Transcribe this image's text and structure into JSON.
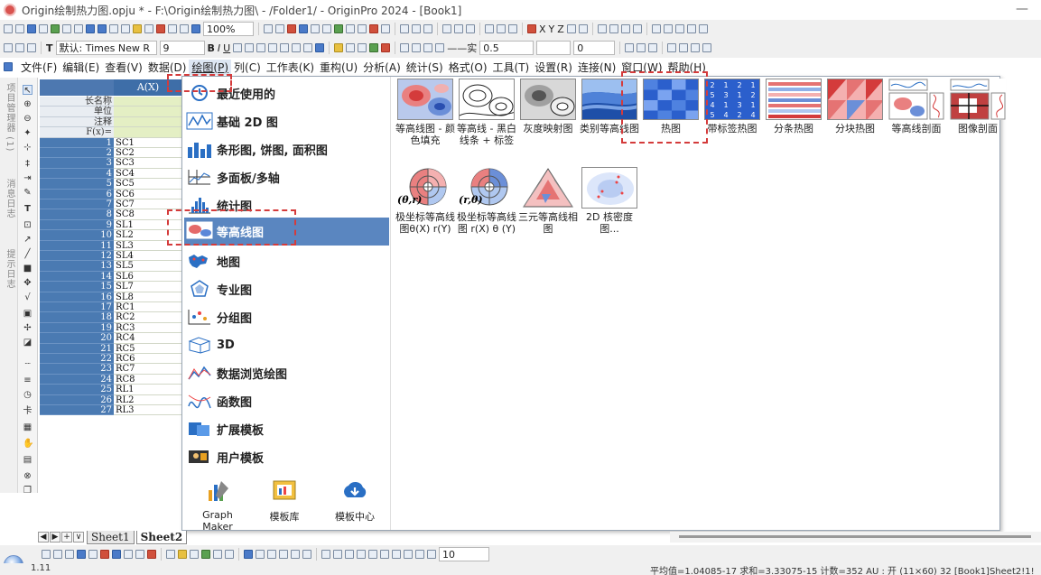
{
  "window": {
    "title": "Origin绘制热力图.opju * - F:\\Origin绘制热力图\\ - /Folder1/ - OriginPro 2024 - [Book1]",
    "minimize": "—"
  },
  "toolbar": {
    "zoom": "100%",
    "font_label": "默认: Times New R",
    "font_size": "9",
    "bold": "B",
    "italic": "I",
    "underline": "U",
    "line_style_label": "实",
    "line_width": "0.5",
    "value_zero": "0",
    "bottom_size": "10",
    "xyz_labels": [
      "X",
      "Y",
      "Z"
    ]
  },
  "menubar": {
    "items": [
      "文件(F)",
      "编辑(E)",
      "查看(V)",
      "数据(D)",
      "绘图(P)",
      "列(C)",
      "工作表(K)",
      "重构(U)",
      "分析(A)",
      "统计(S)",
      "格式(O)",
      "工具(T)",
      "设置(R)",
      "连接(N)",
      "窗口(W)",
      "帮助(H)"
    ]
  },
  "sidebar": {
    "labels": [
      "项目管理器 (1)",
      "消息日志",
      "提示日志"
    ]
  },
  "sheet": {
    "column_header": "A(X)",
    "meta_rows": [
      {
        "h": "长名称",
        "v": ""
      },
      {
        "h": "单位",
        "v": ""
      },
      {
        "h": "注释",
        "v": ""
      },
      {
        "h": "F(x)=",
        "v": ""
      }
    ],
    "rows": [
      {
        "n": "1",
        "v": "SC1"
      },
      {
        "n": "2",
        "v": "SC2"
      },
      {
        "n": "3",
        "v": "SC3"
      },
      {
        "n": "4",
        "v": "SC4"
      },
      {
        "n": "5",
        "v": "SC5"
      },
      {
        "n": "6",
        "v": "SC6"
      },
      {
        "n": "7",
        "v": "SC7"
      },
      {
        "n": "8",
        "v": "SC8"
      },
      {
        "n": "9",
        "v": "SL1"
      },
      {
        "n": "10",
        "v": "SL2"
      },
      {
        "n": "11",
        "v": "SL3"
      },
      {
        "n": "12",
        "v": "SL4"
      },
      {
        "n": "13",
        "v": "SL5"
      },
      {
        "n": "14",
        "v": "SL6"
      },
      {
        "n": "15",
        "v": "SL7"
      },
      {
        "n": "16",
        "v": "SL8"
      },
      {
        "n": "17",
        "v": "RC1"
      },
      {
        "n": "18",
        "v": "RC2"
      },
      {
        "n": "19",
        "v": "RC3"
      },
      {
        "n": "20",
        "v": "RC4"
      },
      {
        "n": "21",
        "v": "RC5"
      },
      {
        "n": "22",
        "v": "RC6"
      },
      {
        "n": "23",
        "v": "RC7"
      },
      {
        "n": "24",
        "v": "RC8"
      },
      {
        "n": "25",
        "v": "RL1"
      },
      {
        "n": "26",
        "v": "RL2"
      },
      {
        "n": "27",
        "v": "RL3"
      }
    ],
    "tabs": [
      "Sheet1",
      "Sheet2"
    ],
    "active_tab": "Sheet2"
  },
  "plot_menu": {
    "categories": [
      "最近使用的",
      "基础 2D 图",
      "条形图, 饼图, 面积图",
      "多面板/多轴",
      "统计图",
      "等高线图",
      "地图",
      "专业图",
      "分组图",
      "3D",
      "数据浏览绘图",
      "函数图",
      "扩展模板",
      "用户模板"
    ],
    "selected": "等高线图",
    "bottom_buttons": [
      "Graph Maker",
      "模板库",
      "模板中心"
    ],
    "gallery_row1": [
      "等高线图 - 颜色填充",
      "等高线 - 黑白线条 + 标签",
      "灰度映射图",
      "类别等高线图",
      "热图",
      "带标签热图",
      "分条热图",
      "分块热图",
      "等高线剖面",
      "图像剖面"
    ],
    "gallery_row2": [
      "极坐标等高线图θ(X) r(Y)",
      "极坐标等高线图 r(X) θ (Y)",
      "三元等高线相图",
      "2D 核密度图..."
    ],
    "theta_r": "(θ,r)",
    "r_theta": "(r,θ)"
  },
  "statusbar": {
    "left": "1.11",
    "right": "平均值=1.04085-17 求和=3.33075-15 计数=352    AU : 开    (11×60) 32    [Book1]Sheet2!1!"
  }
}
